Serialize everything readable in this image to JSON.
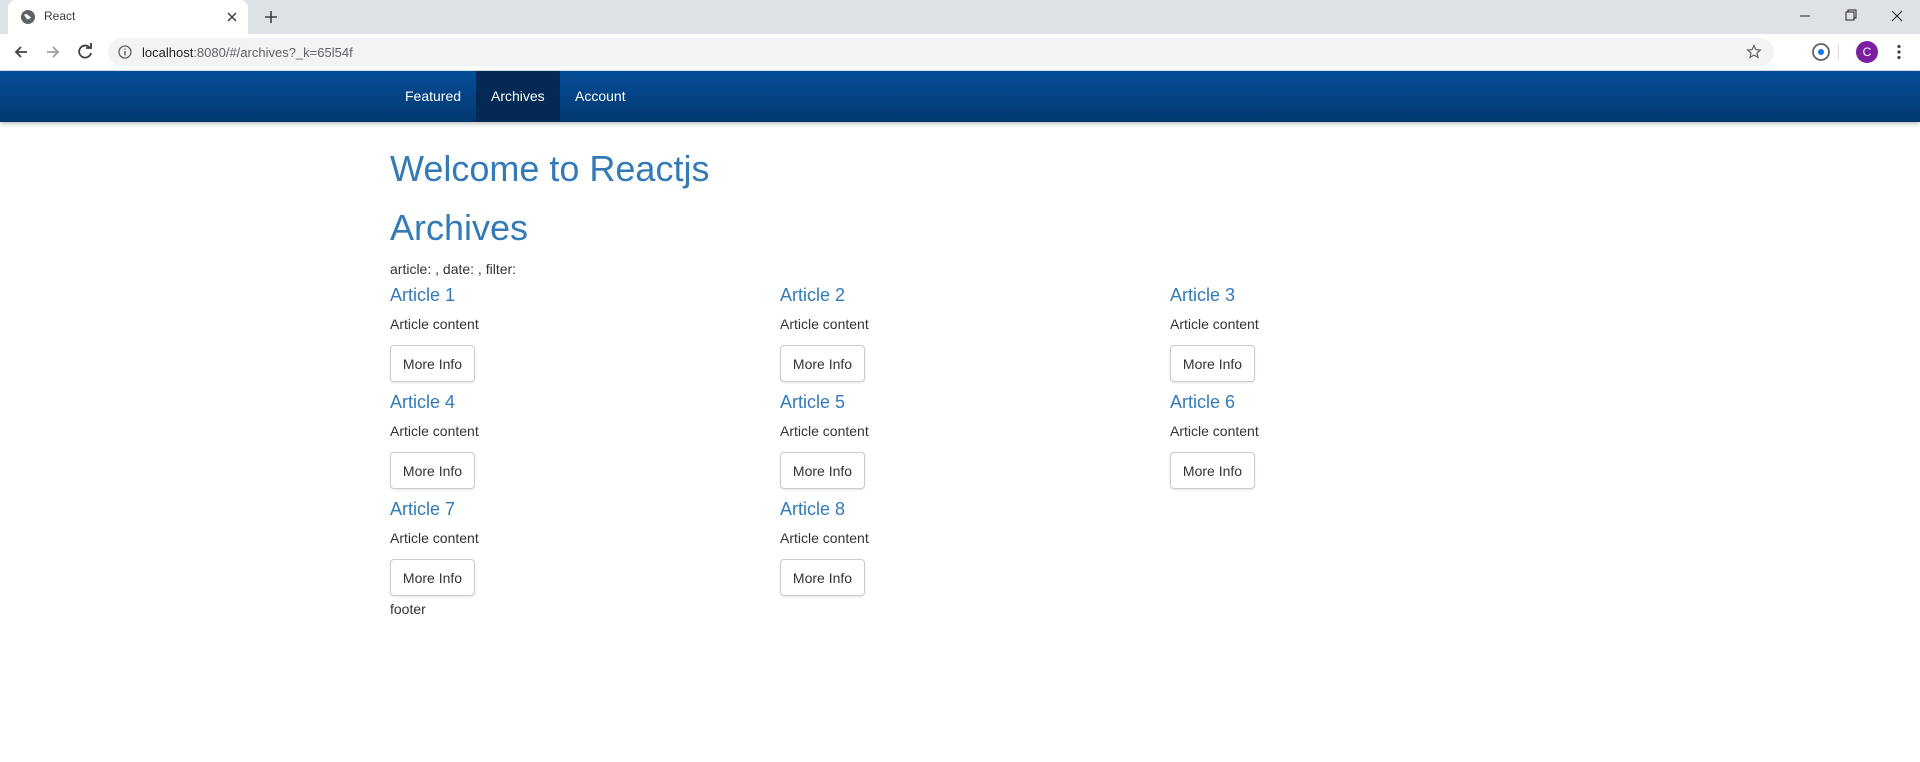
{
  "browser": {
    "tab_title": "React",
    "url_host": "localhost",
    "url_rest": ":8080/#/archives?_k=65l54f",
    "avatar_letter": "C"
  },
  "navbar": {
    "items": [
      {
        "label": "Featured",
        "active": false
      },
      {
        "label": "Archives",
        "active": true
      },
      {
        "label": "Account",
        "active": false
      }
    ]
  },
  "page": {
    "welcome_heading": "Welcome to Reactjs",
    "section_heading": "Archives",
    "params_text": "article: , date: , filter:",
    "footer": "footer"
  },
  "articles": [
    {
      "title": "Article 1",
      "content": "Article content",
      "button": "More Info"
    },
    {
      "title": "Article 2",
      "content": "Article content",
      "button": "More Info"
    },
    {
      "title": "Article 3",
      "content": "Article content",
      "button": "More Info"
    },
    {
      "title": "Article 4",
      "content": "Article content",
      "button": "More Info"
    },
    {
      "title": "Article 5",
      "content": "Article content",
      "button": "More Info"
    },
    {
      "title": "Article 6",
      "content": "Article content",
      "button": "More Info"
    },
    {
      "title": "Article 7",
      "content": "Article content",
      "button": "More Info"
    },
    {
      "title": "Article 8",
      "content": "Article content",
      "button": "More Info"
    }
  ],
  "colors": {
    "link": "#337ab7",
    "navbar_top": "#054e9a",
    "navbar_bottom": "#03386f",
    "navbar_active": "#032a55",
    "avatar": "#7b1fa2"
  },
  "icons": [
    "globe-icon",
    "close-icon",
    "plus-icon",
    "minimize-icon",
    "restore-icon",
    "back-arrow-icon",
    "forward-arrow-icon",
    "reload-icon",
    "info-icon",
    "star-icon",
    "extension-icon",
    "kebab-menu-icon"
  ]
}
